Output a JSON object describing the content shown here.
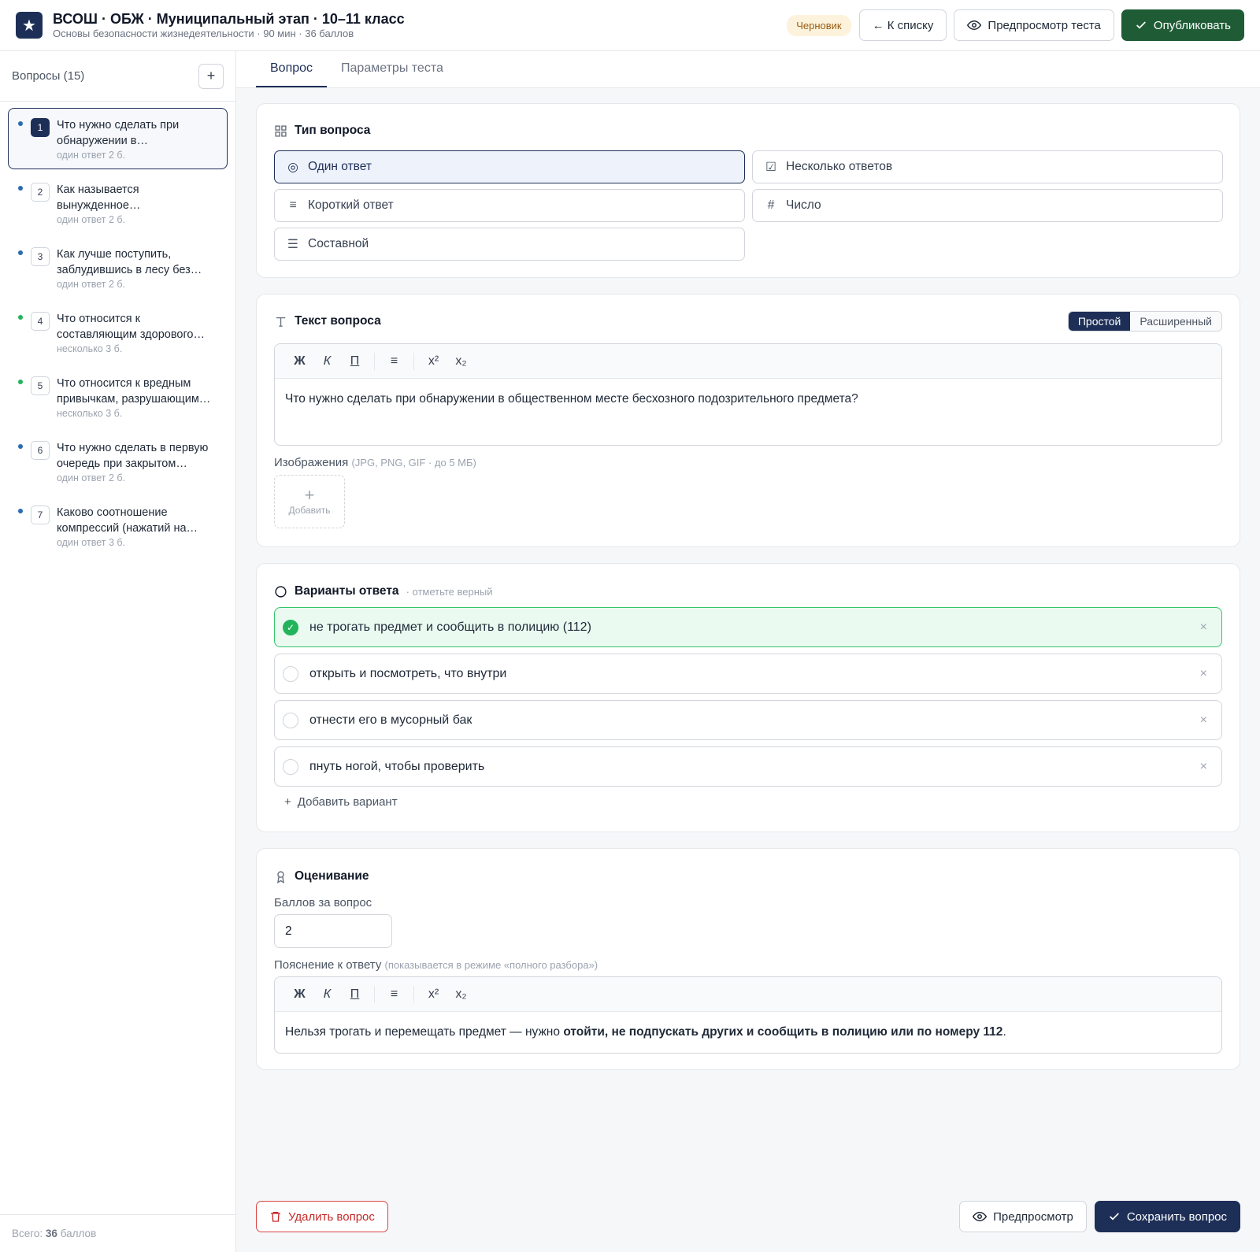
{
  "header": {
    "logo_glyph": "★",
    "title": "ВСОШ · ОБЖ · Муниципальный этап · 10–11 класс",
    "subtitle": "Основы безопасности жизнедеятельности · 90 мин · 36 баллов",
    "status_badge": "Черновик",
    "back_label": "← К списку",
    "preview_test_label": "Предпросмотр теста",
    "publish_label": "Опубликовать"
  },
  "sidebar": {
    "heading": "Вопросы (15)",
    "add_glyph": "+",
    "footer_prefix": "Всего:",
    "footer_total": "36",
    "footer_suffix": "баллов",
    "questions": [
      {
        "num": "1",
        "text": "Что нужно сделать при обнаружении в…",
        "meta": "один ответ  2 б.",
        "dot": "#2b6cb0",
        "active": true
      },
      {
        "num": "2",
        "text": "Как называется вынужденное…",
        "meta": "один ответ  2 б.",
        "dot": "#2b6cb0",
        "active": false
      },
      {
        "num": "3",
        "text": "Как лучше поступить, заблудившись в лесу без…",
        "meta": "один ответ  2 б.",
        "dot": "#2b6cb0",
        "active": false
      },
      {
        "num": "4",
        "text": "Что относится к составляющим здорового…",
        "meta": "несколько  3 б.",
        "dot": "#22b45a",
        "active": false
      },
      {
        "num": "5",
        "text": "Что относится к вредным привычкам, разрушающим…",
        "meta": "несколько  3 б.",
        "dot": "#22b45a",
        "active": false
      },
      {
        "num": "6",
        "text": "Что нужно сделать в первую очередь при закрытом…",
        "meta": "один ответ  2 б.",
        "dot": "#2b6cb0",
        "active": false
      },
      {
        "num": "7",
        "text": "Каково соотношение компрессий (нажатий на…",
        "meta": "один ответ  3 б.",
        "dot": "#2b6cb0",
        "active": false
      }
    ]
  },
  "tabs": [
    {
      "label": "Вопрос",
      "active": true
    },
    {
      "label": "Параметры теста",
      "active": false
    }
  ],
  "question_type": {
    "title": "Тип вопроса",
    "options": [
      {
        "label": "Один ответ",
        "icon": "radio-icon",
        "glyph": "◎",
        "selected": true
      },
      {
        "label": "Несколько ответов",
        "icon": "checkbox-icon",
        "glyph": "☑",
        "selected": false
      },
      {
        "label": "Короткий ответ",
        "icon": "lines-icon",
        "glyph": "≡",
        "selected": false
      },
      {
        "label": "Число",
        "icon": "hash-icon",
        "glyph": "#",
        "selected": false
      },
      {
        "label": "Составной",
        "icon": "list-icon",
        "glyph": "☰",
        "selected": false
      }
    ]
  },
  "question_text": {
    "title": "Текст вопроса",
    "mode_simple": "Простой",
    "mode_advanced": "Расширенный",
    "toolbar": {
      "bold": "Ж",
      "italic": "К",
      "underline": "П",
      "list": "≡",
      "sup": "x²",
      "sub": "x₂"
    },
    "body": "Что нужно сделать при обнаружении в общественном месте бесхозного подозрительного предмета?",
    "images_label": "Изображения",
    "images_hint": "(JPG, PNG, GIF · до 5 МБ)",
    "add_image_label": "Добавить"
  },
  "answers": {
    "title": "Варианты ответа",
    "hint": "· отметьте верный",
    "items": [
      {
        "text": "не трогать предмет и сообщить в полицию (112)",
        "correct": true
      },
      {
        "text": "открыть и посмотреть, что внутри",
        "correct": false
      },
      {
        "text": "отнести его в мусорный бак",
        "correct": false
      },
      {
        "text": "пнуть ногой, чтобы проверить",
        "correct": false
      }
    ],
    "remove_glyph": "×",
    "add_label": "Добавить вариант"
  },
  "grading": {
    "title": "Оценивание",
    "points_label": "Баллов за вопрос",
    "points_value": "2",
    "explanation_label": "Пояснение к ответу",
    "explanation_hint": "(показывается в режиме «полного разбора»)",
    "explanation_plain": "Нельзя трогать и перемещать предмет — нужно ",
    "explanation_bold": "отойти, не подпускать других и сообщить в полицию или по номеру 112",
    "explanation_end": "."
  },
  "footer": {
    "delete_label": "Удалить вопрос",
    "preview_label": "Предпросмотр",
    "save_label": "Сохранить вопрос"
  },
  "colors": {
    "navy": "#1e2f57",
    "green": "#1f5c36",
    "correct": "#22b45a",
    "danger": "#c62828"
  }
}
